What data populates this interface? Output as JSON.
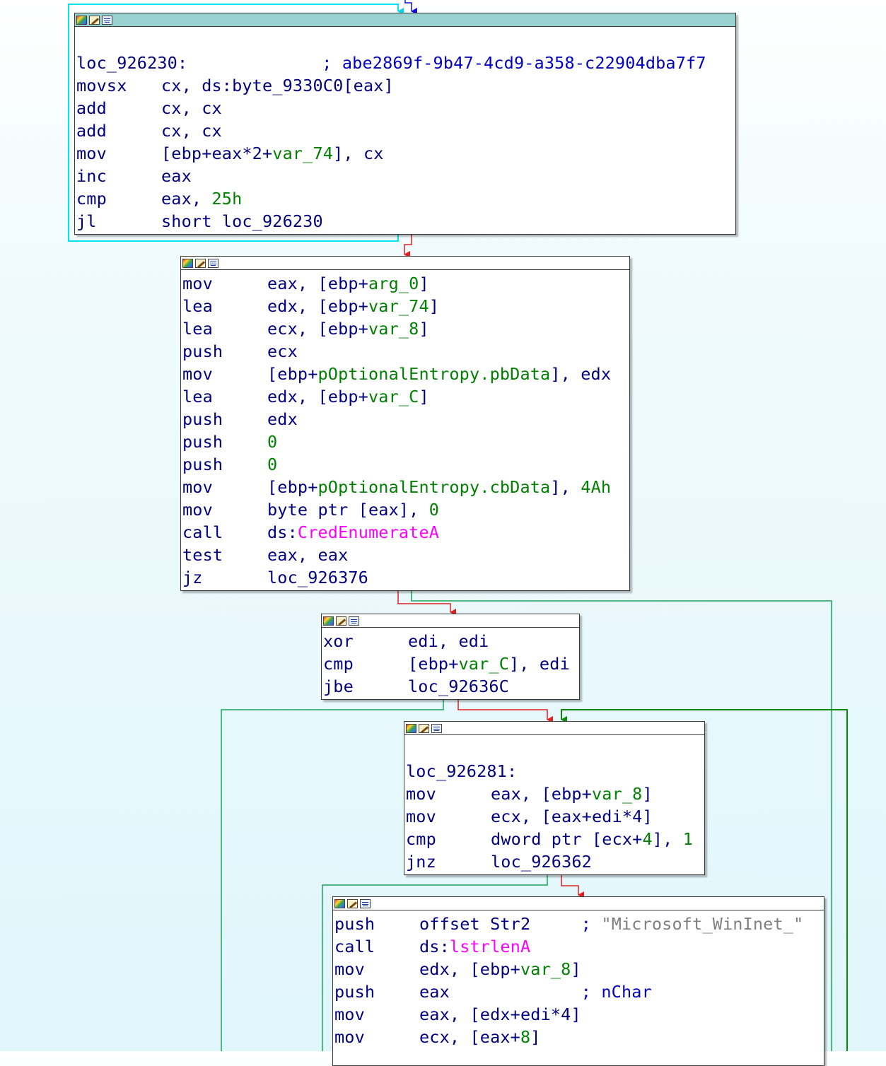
{
  "colors": {
    "edge_loop": "#00e5f0",
    "edge_false": "#e02020",
    "edge_true": "#1aa35a",
    "edge_back": "#0a8a0a",
    "edge_blue": "#1010d0",
    "selected_title": "#99d0d0"
  },
  "icons": [
    "color-palette-icon",
    "edit-pencil-icon",
    "graph-view-icon"
  ],
  "blocks": [
    {
      "id": "block-926230",
      "lines": [
        [],
        [
          {
            "t": "loc_926230:"
          },
          {
            "pad": " "
          },
          {
            "t": "; abe2869f-9b47-4cd9-a358-c22904dba7f7",
            "c": "cmt"
          }
        ],
        [
          {
            "m": "movsx"
          },
          {
            "t": "cx, ds:byte_9330C0[eax]"
          }
        ],
        [
          {
            "m": "add"
          },
          {
            "t": "cx, cx"
          }
        ],
        [
          {
            "m": "add"
          },
          {
            "t": "cx, cx"
          }
        ],
        [
          {
            "m": "mov"
          },
          {
            "t": "[ebp+eax*2+"
          },
          {
            "t": "var_74",
            "c": "var"
          },
          {
            "t": "], cx"
          }
        ],
        [
          {
            "m": "inc"
          },
          {
            "t": "eax"
          }
        ],
        [
          {
            "m": "cmp"
          },
          {
            "t": "eax, "
          },
          {
            "t": "25h",
            "c": "num"
          }
        ],
        [
          {
            "m": "jl"
          },
          {
            "t": "short loc_926230"
          }
        ]
      ]
    },
    {
      "id": "block-cred-enumerate",
      "lines": [
        [
          {
            "m": "mov"
          },
          {
            "t": "eax, [ebp+"
          },
          {
            "t": "arg_0",
            "c": "var"
          },
          {
            "t": "]"
          }
        ],
        [
          {
            "m": "lea"
          },
          {
            "t": "edx, [ebp+"
          },
          {
            "t": "var_74",
            "c": "var"
          },
          {
            "t": "]"
          }
        ],
        [
          {
            "m": "lea"
          },
          {
            "t": "ecx, [ebp+"
          },
          {
            "t": "var_8",
            "c": "var"
          },
          {
            "t": "]"
          }
        ],
        [
          {
            "m": "push"
          },
          {
            "t": "ecx"
          }
        ],
        [
          {
            "m": "mov"
          },
          {
            "t": "[ebp+"
          },
          {
            "t": "pOptionalEntropy.pbData",
            "c": "var"
          },
          {
            "t": "], edx"
          }
        ],
        [
          {
            "m": "lea"
          },
          {
            "t": "edx, [ebp+"
          },
          {
            "t": "var_C",
            "c": "var"
          },
          {
            "t": "]"
          }
        ],
        [
          {
            "m": "push"
          },
          {
            "t": "edx"
          }
        ],
        [
          {
            "m": "push"
          },
          {
            "t": "0",
            "c": "num"
          }
        ],
        [
          {
            "m": "push"
          },
          {
            "t": "0",
            "c": "num"
          }
        ],
        [
          {
            "m": "mov"
          },
          {
            "t": "[ebp+"
          },
          {
            "t": "pOptionalEntropy.cbData",
            "c": "var"
          },
          {
            "t": "], "
          },
          {
            "t": "4Ah",
            "c": "num"
          }
        ],
        [
          {
            "m": "mov"
          },
          {
            "t": "byte ptr [eax], "
          },
          {
            "t": "0",
            "c": "num"
          }
        ],
        [
          {
            "m": "call"
          },
          {
            "t": "ds:"
          },
          {
            "t": "CredEnumerateA",
            "c": "imp"
          }
        ],
        [
          {
            "m": "test"
          },
          {
            "t": "eax, eax"
          }
        ],
        [
          {
            "m": "jz"
          },
          {
            "t": "loc_926376"
          }
        ]
      ]
    },
    {
      "id": "block-xor-edi",
      "lines": [
        [
          {
            "m": "xor"
          },
          {
            "t": "edi, edi"
          }
        ],
        [
          {
            "m": "cmp"
          },
          {
            "t": "[ebp+"
          },
          {
            "t": "var_C",
            "c": "var"
          },
          {
            "t": "], edi"
          }
        ],
        [
          {
            "m": "jbe"
          },
          {
            "t": "loc_92636C"
          }
        ]
      ]
    },
    {
      "id": "block-926281",
      "lines": [
        [],
        [
          {
            "t": "loc_926281:"
          }
        ],
        [
          {
            "m": "mov"
          },
          {
            "t": "eax, [ebp+"
          },
          {
            "t": "var_8",
            "c": "var"
          },
          {
            "t": "]"
          }
        ],
        [
          {
            "m": "mov"
          },
          {
            "t": "ecx, [eax+edi*4]"
          }
        ],
        [
          {
            "m": "cmp"
          },
          {
            "t": "dword ptr [ecx+"
          },
          {
            "t": "4",
            "c": "num"
          },
          {
            "t": "], "
          },
          {
            "t": "1",
            "c": "num"
          }
        ],
        [
          {
            "m": "jnz"
          },
          {
            "t": "loc_926362"
          }
        ]
      ]
    },
    {
      "id": "block-lstrlen",
      "lines": [
        [
          {
            "m": "push"
          },
          {
            "t": "offset Str2     "
          },
          {
            "t": "; ",
            "c": "cmt"
          },
          {
            "t": "\"Microsoft_WinInet_\"",
            "c": "str"
          }
        ],
        [
          {
            "m": "call"
          },
          {
            "t": "ds:"
          },
          {
            "t": "lstrlenA",
            "c": "imp"
          }
        ],
        [
          {
            "m": "mov"
          },
          {
            "t": "edx, [ebp+"
          },
          {
            "t": "var_8",
            "c": "var"
          },
          {
            "t": "]"
          }
        ],
        [
          {
            "m": "push"
          },
          {
            "t": "eax             "
          },
          {
            "t": "; nChar",
            "c": "cmt"
          }
        ],
        [
          {
            "m": "mov"
          },
          {
            "t": "eax, [edx+edi*4]"
          }
        ],
        [
          {
            "m": "mov"
          },
          {
            "t": "ecx, [eax+"
          },
          {
            "t": "8",
            "c": "num"
          },
          {
            "t": "]"
          }
        ]
      ]
    }
  ]
}
